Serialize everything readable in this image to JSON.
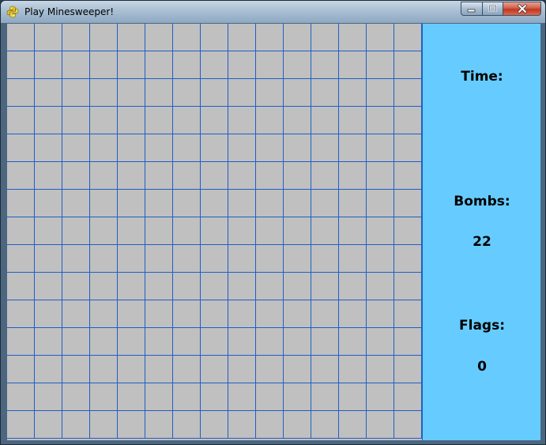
{
  "window": {
    "title": "Play Minesweeper!",
    "icon": "python-icon"
  },
  "board": {
    "columns": 15,
    "rows": 15,
    "cell_color": "#c0c0c0",
    "grid_line_color": "#1f5fc4"
  },
  "panel": {
    "background": "#66ccff",
    "time_label": "Time:",
    "time_value": "",
    "bombs_label": "Bombs:",
    "bombs_value": "22",
    "flags_label": "Flags:",
    "flags_value": "0"
  }
}
